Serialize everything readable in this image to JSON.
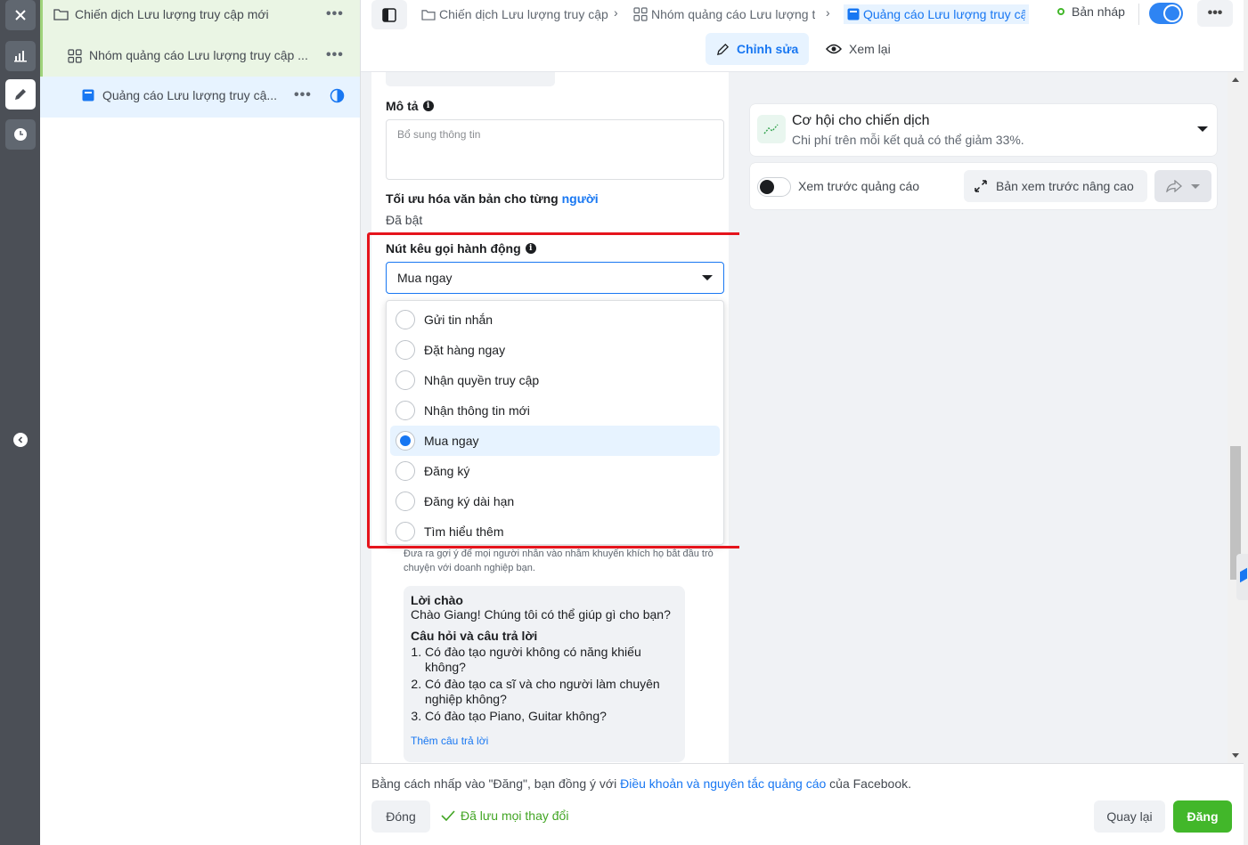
{
  "colors": {
    "accent": "#1877f2",
    "success": "#42b72a",
    "highlight": "#e5141c",
    "rail": "#4b4f56"
  },
  "rail": {
    "icons": [
      "close-icon",
      "chart-icon",
      "pencil-icon",
      "clock-icon",
      "chevron-left-icon"
    ]
  },
  "tree": {
    "campaign": "Chiến dịch Lưu lượng truy cập mới",
    "adset": "Nhóm quảng cáo Lưu lượng truy cập ...",
    "ad": "Quảng cáo Lưu lượng truy cậ...",
    "more": "•••"
  },
  "topbar": {
    "crumb_campaign": "Chiến dịch Lưu lượng truy cập",
    "crumb_adset": "Nhóm quảng cáo Lưu lượng t",
    "crumb_ad": "Quảng cáo Lưu lượng truy cậ",
    "status": "Bản nháp",
    "more": "•••",
    "tab_edit": "Chỉnh sửa",
    "tab_review": "Xem lại"
  },
  "form": {
    "description_label": "Mô tả",
    "description_placeholder": "Bổ sung thông tin",
    "optimize_label_prefix": "Tối ưu hóa văn bản cho từng",
    "optimize_label_link": "người",
    "optimize_value": "Đã bật",
    "cta_label": "Nút kêu gọi hành động",
    "cta_selected": "Mua ngay",
    "cta_options": [
      "Gửi tin nhắn",
      "Đặt hàng ngay",
      "Nhận quyền truy cập",
      "Nhận thông tin mới",
      "Mua ngay",
      "Đăng ký",
      "Đăng ký dài hạn",
      "Tìm hiểu thêm"
    ],
    "hint": "Đưa ra gợi ý để mọi người nhắn vào nhằm khuyến khích họ bắt đầu trò chuyện với doanh nghiệp bạn.",
    "greeting_title": "Lời chào",
    "greeting_text": "Chào Giang! Chúng tôi có thể giúp gì cho bạn?",
    "qa_title": "Câu hỏi và câu trả lời",
    "questions": [
      "Có đào tạo người không có năng khiếu không?",
      "Có đào tạo ca sĩ và cho người làm chuyên nghiệp không?",
      "Có đào tạo Piano, Guitar không?"
    ],
    "add_answer": "Thêm câu trả lời"
  },
  "preview": {
    "opp_title": "Cơ hội cho chiến dịch",
    "opp_sub": "Chi phí trên mỗi kết quả có thể giảm 33%.",
    "preview_label": "Xem trước quảng cáo",
    "advanced_label": "Bản xem trước nâng cao"
  },
  "footer": {
    "terms_prefix": "Bằng cách nhấp vào \"Đăng\", bạn đồng ý với ",
    "terms_link": "Điều khoản và nguyên tắc quảng cáo",
    "terms_suffix": " của Facebook.",
    "close": "Đóng",
    "saved": "Đã lưu mọi thay đổi",
    "back": "Quay lại",
    "publish": "Đăng"
  }
}
